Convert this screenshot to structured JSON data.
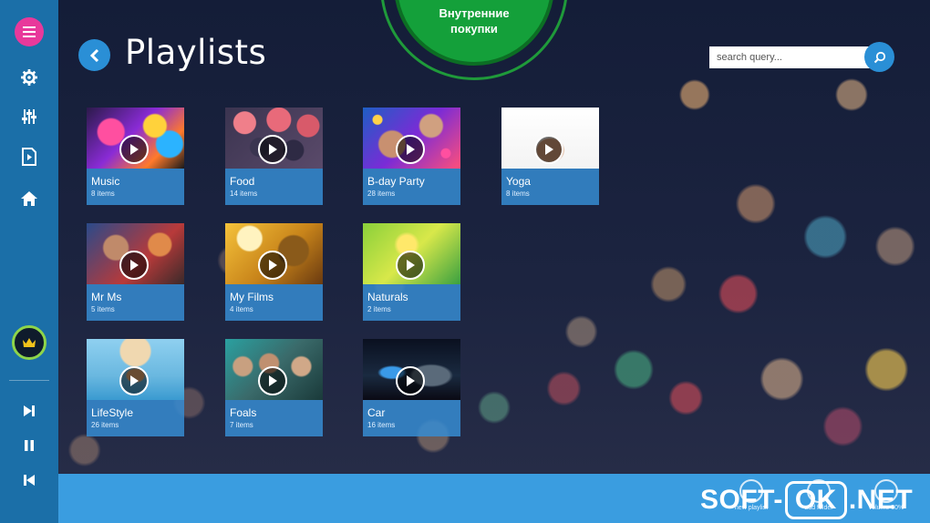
{
  "promo": {
    "text": "Внутренние\nпокупки"
  },
  "header": {
    "title": "Playlists"
  },
  "search": {
    "placeholder": "search query..."
  },
  "sidebar": {
    "top_items": [
      {
        "icon": "menu-icon"
      },
      {
        "icon": "gear-icon"
      },
      {
        "icon": "equalizer-icon"
      },
      {
        "icon": "media-file-icon"
      },
      {
        "icon": "home-icon"
      }
    ],
    "premium": {
      "icon": "crown-icon"
    },
    "transport": [
      {
        "icon": "next-track-icon"
      },
      {
        "icon": "pause-icon"
      },
      {
        "icon": "previous-track-icon"
      }
    ]
  },
  "playlists": [
    {
      "name": "Music",
      "count": "8 items"
    },
    {
      "name": "Food",
      "count": "14 items"
    },
    {
      "name": "B-day Party",
      "count": "28 items"
    },
    {
      "name": "Yoga",
      "count": "8 items"
    },
    {
      "name": "Mr Ms",
      "count": "5 items"
    },
    {
      "name": "My Films",
      "count": "4 items"
    },
    {
      "name": "Naturals",
      "count": "2 items"
    },
    {
      "name": "LifeStyle",
      "count": "26 items"
    },
    {
      "name": "Foals",
      "count": "7 items"
    },
    {
      "name": "Car",
      "count": "16 items"
    }
  ],
  "bottom_bar": {
    "actions": [
      {
        "label": "new playlist"
      },
      {
        "label": "add folder"
      },
      {
        "label": "volume 50%"
      }
    ]
  },
  "watermark": {
    "left": "SOFT-",
    "mid": "OK",
    "right": ".NET"
  },
  "colors": {
    "sidebar": "#1b6fa8",
    "accent_blue": "#2a8fd6",
    "menu_pink": "#e8399b",
    "promo_green": "#14a03a",
    "premium_ring": "#8ed54a"
  }
}
